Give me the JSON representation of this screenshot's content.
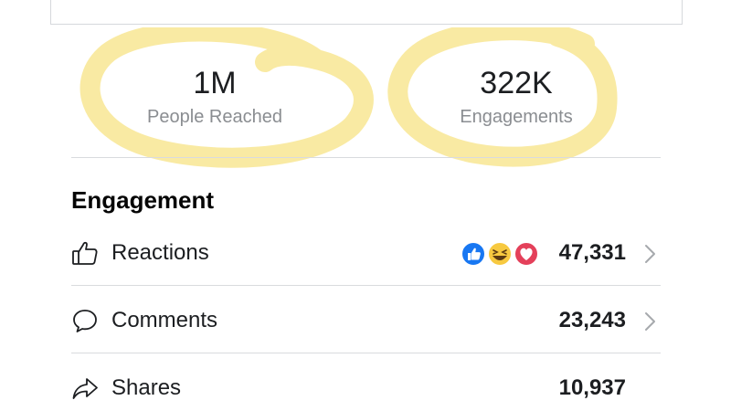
{
  "stats": {
    "people_reached_value": "1M",
    "people_reached_label": "People Reached",
    "engagements_value": "322K",
    "engagements_label": "Engagements"
  },
  "engagement": {
    "title": "Engagement",
    "rows": [
      {
        "label": "Reactions",
        "value": "47,331",
        "icon": "thumbs-up-icon"
      },
      {
        "label": "Comments",
        "value": "23,243",
        "icon": "comment-icon"
      },
      {
        "label": "Shares",
        "value": "10,937",
        "icon": "share-icon"
      }
    ]
  },
  "colors": {
    "highlighter": "#f6dd6a",
    "like_blue": "#1877f2",
    "haha_yellow": "#f7c940",
    "love_red": "#e4405a"
  }
}
